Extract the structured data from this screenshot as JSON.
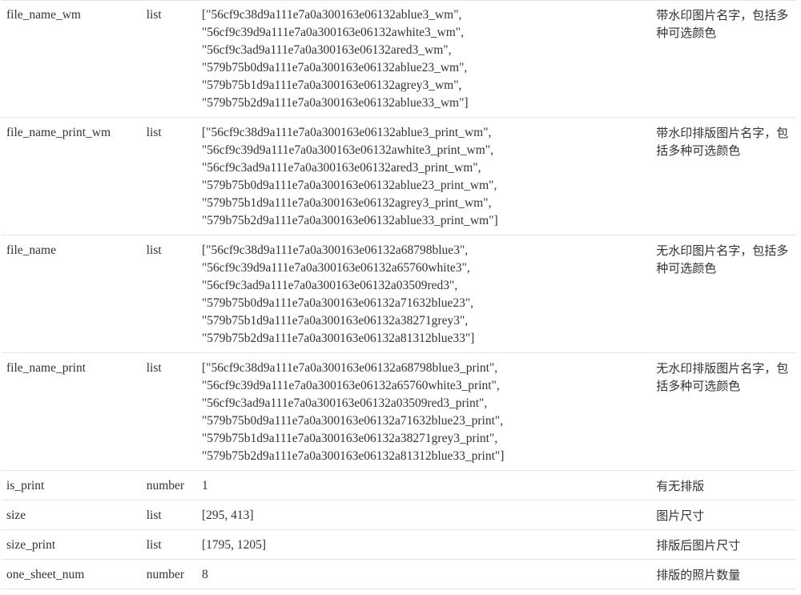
{
  "rows": [
    {
      "name": "file_name_wm",
      "type": "list",
      "value_lines": [
        "[\"56cf9c38d9a111e7a0a300163e06132ablue3_wm\",",
        "\"56cf9c39d9a111e7a0a300163e06132awhite3_wm\",",
        "\"56cf9c3ad9a111e7a0a300163e06132ared3_wm\",",
        "\"579b75b0d9a111e7a0a300163e06132ablue23_wm\",",
        "\"579b75b1d9a111e7a0a300163e06132agrey3_wm\",",
        "\"579b75b2d9a111e7a0a300163e06132ablue33_wm\"]"
      ],
      "desc": "带水印图片名字，包括多种可选颜色"
    },
    {
      "name": "file_name_print_wm",
      "type": "list",
      "value_lines": [
        "[\"56cf9c38d9a111e7a0a300163e06132ablue3_print_wm\",",
        "\"56cf9c39d9a111e7a0a300163e06132awhite3_print_wm\",",
        "\"56cf9c3ad9a111e7a0a300163e06132ared3_print_wm\",",
        "\"579b75b0d9a111e7a0a300163e06132ablue23_print_wm\",",
        "\"579b75b1d9a111e7a0a300163e06132agrey3_print_wm\",",
        "\"579b75b2d9a111e7a0a300163e06132ablue33_print_wm\"]"
      ],
      "desc": "带水印排版图片名字，包括多种可选颜色"
    },
    {
      "name": "file_name",
      "type": "list",
      "value_lines": [
        "[\"56cf9c38d9a111e7a0a300163e06132a68798blue3\",",
        "\"56cf9c39d9a111e7a0a300163e06132a65760white3\",",
        "\"56cf9c3ad9a111e7a0a300163e06132a03509red3\",",
        "\"579b75b0d9a111e7a0a300163e06132a71632blue23\",",
        "\"579b75b1d9a111e7a0a300163e06132a38271grey3\",",
        "\"579b75b2d9a111e7a0a300163e06132a81312blue33\"]"
      ],
      "desc": "无水印图片名字，包括多种可选颜色"
    },
    {
      "name": "file_name_print",
      "type": "list",
      "value_lines": [
        "[\"56cf9c38d9a111e7a0a300163e06132a68798blue3_print\",",
        "\"56cf9c39d9a111e7a0a300163e06132a65760white3_print\",",
        "\"56cf9c3ad9a111e7a0a300163e06132a03509red3_print\",",
        "\"579b75b0d9a111e7a0a300163e06132a71632blue23_print\",",
        "\"579b75b1d9a111e7a0a300163e06132a38271grey3_print\",",
        "\"579b75b2d9a111e7a0a300163e06132a81312blue33_print\"]"
      ],
      "desc": "无水印排版图片名字，包括多种可选颜色"
    },
    {
      "name": "is_print",
      "type": "number",
      "value_lines": [
        "1"
      ],
      "desc": "有无排版"
    },
    {
      "name": "size",
      "type": "list",
      "value_lines": [
        "[295, 413]"
      ],
      "desc": "图片尺寸"
    },
    {
      "name": "size_print",
      "type": "list",
      "value_lines": [
        "[1795, 1205]"
      ],
      "desc": "排版后图片尺寸"
    },
    {
      "name": "one_sheet_num",
      "type": "number",
      "value_lines": [
        "8"
      ],
      "desc": "排版的照片数量"
    }
  ]
}
